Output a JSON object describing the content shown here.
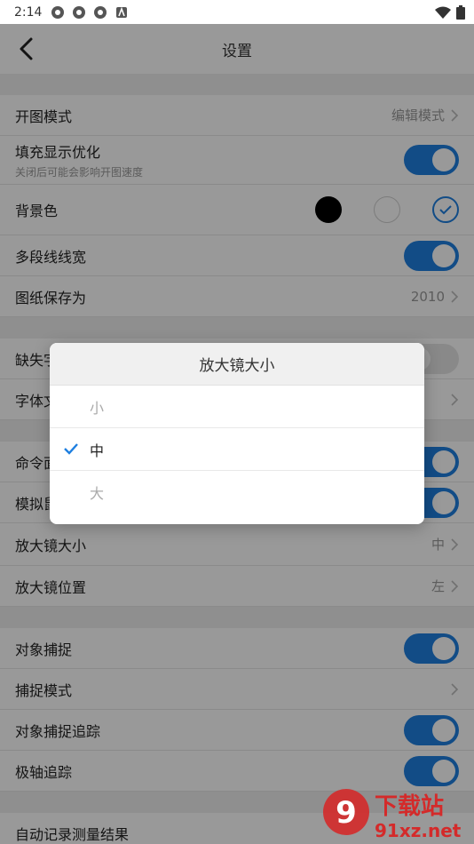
{
  "status_bar": {
    "time": "2:14"
  },
  "header": {
    "title": "设置"
  },
  "settings": {
    "open_mode": {
      "label": "开图模式",
      "value": "编辑模式"
    },
    "fill_opt": {
      "label": "填充显示优化",
      "sub": "关闭后可能会影响开图速度",
      "on": true
    },
    "bg_color": {
      "label": "背景色",
      "options": [
        "black",
        "white",
        "blue-selected"
      ]
    },
    "polyline_width": {
      "label": "多段线线宽",
      "on": true
    },
    "save_as": {
      "label": "图纸保存为",
      "value": "2010"
    },
    "missing_font": {
      "label": "缺失字",
      "on": false
    },
    "font_file": {
      "label": "字体文"
    },
    "command_panel": {
      "label": "命令面",
      "on": true
    },
    "simulate": {
      "label": "模拟鼠",
      "on": true
    },
    "magnifier_size": {
      "label": "放大镜大小",
      "value": "中"
    },
    "magnifier_pos": {
      "label": "放大镜位置",
      "value": "左"
    },
    "snap": {
      "label": "对象捕捉",
      "on": true
    },
    "snap_mode": {
      "label": "捕捉模式"
    },
    "snap_track": {
      "label": "对象捕捉追踪",
      "on": true
    },
    "polar_track": {
      "label": "极轴追踪",
      "on": true
    },
    "auto_record": {
      "label": "自动记录测量结果"
    }
  },
  "dialog": {
    "title": "放大镜大小",
    "options": [
      {
        "label": "小",
        "selected": false
      },
      {
        "label": "中",
        "selected": true
      },
      {
        "label": "大",
        "selected": false
      }
    ]
  },
  "colors": {
    "accent": "#1e7fe0",
    "overlay": "rgba(0,0,0,0.40)"
  },
  "watermark": {
    "brand": "下载站",
    "url": "91xz.net",
    "logo": "9"
  }
}
